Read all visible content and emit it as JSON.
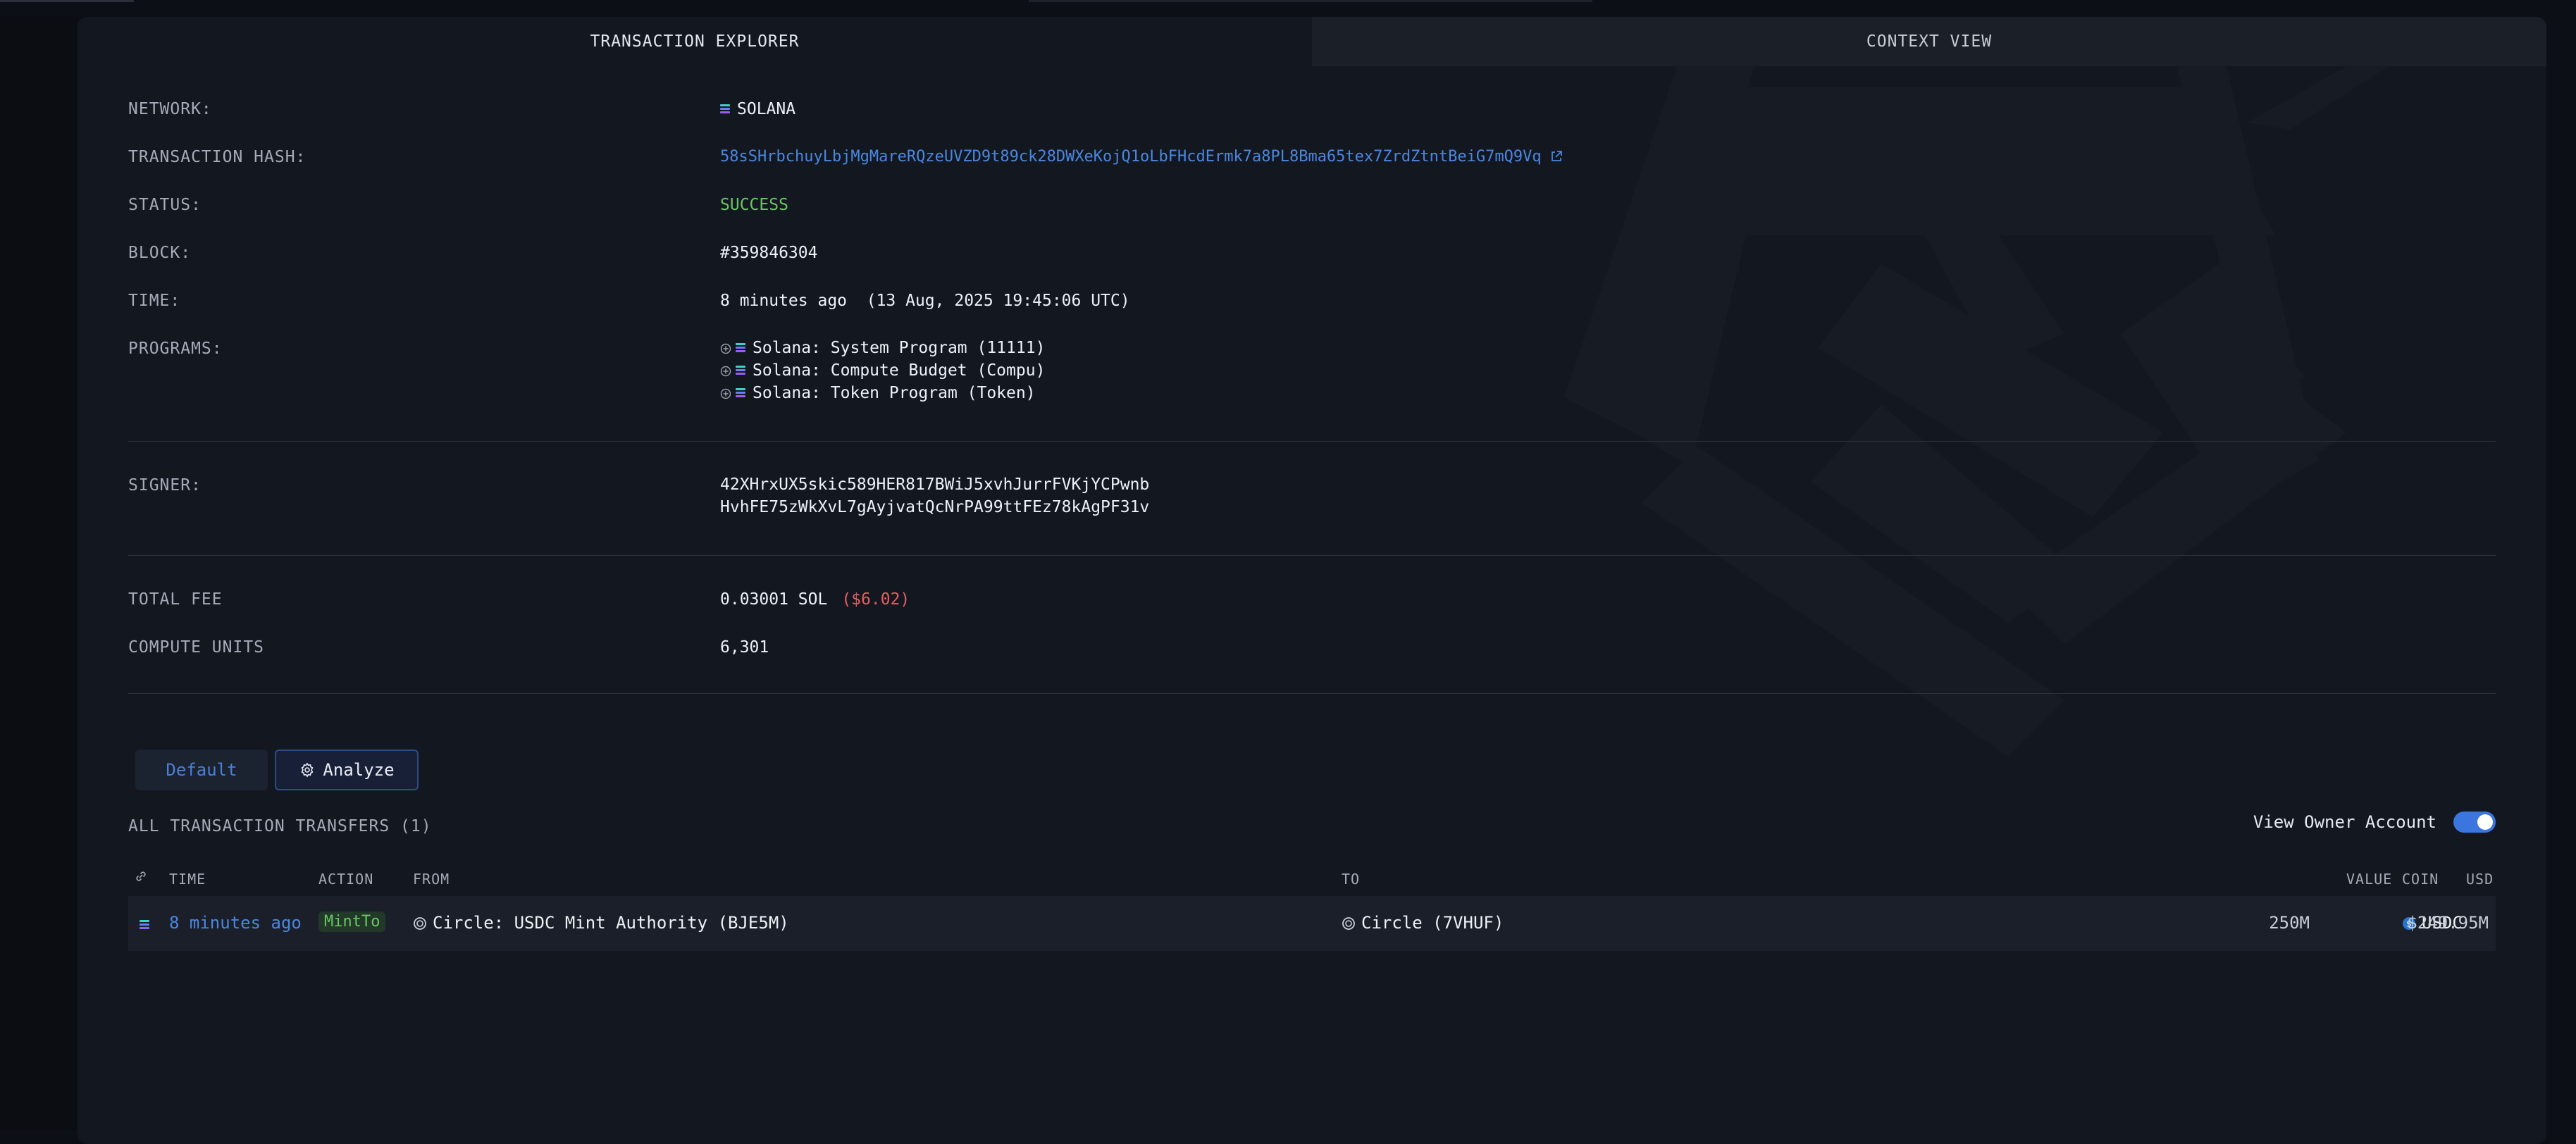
{
  "tabs": {
    "explorer": "TRANSACTION EXPLORER",
    "context": "CONTEXT VIEW"
  },
  "details": {
    "network": {
      "label": "NETWORK:",
      "value": "SOLANA"
    },
    "hash": {
      "label": "TRANSACTION HASH:",
      "value": "58sSHrbchuyLbjMgMareRQzeUVZD9t89ck28DWXeKojQ1oLbFHcdErmk7a8PL8Bma65tex7ZrdZtntBeiG7mQ9Vq"
    },
    "status": {
      "label": "STATUS:",
      "value": "SUCCESS"
    },
    "block": {
      "label": "BLOCK:",
      "value": "#359846304"
    },
    "time": {
      "label": "TIME:",
      "relative": "8 minutes ago",
      "absolute": "(13 Aug, 2025 19:45:06 UTC)"
    },
    "programs": {
      "label": "PROGRAMS:",
      "items": [
        "Solana: System Program (11111)",
        "Solana: Compute Budget (Compu)",
        "Solana: Token Program (Token)"
      ]
    },
    "signer": {
      "label": "SIGNER:",
      "lines": [
        "42XHrxUX5skic589HER817BWiJ5xvhJurrFVKjYCPwnb",
        "HvhFE75zWkXvL7gAyjvatQcNrPA99ttFEz78kAgPF31v"
      ]
    },
    "fee": {
      "label": "TOTAL FEE",
      "value": "0.03001 SOL",
      "usd": "($6.02)"
    },
    "compute": {
      "label": "COMPUTE UNITS",
      "value": "6,301"
    }
  },
  "buttons": {
    "default": "Default",
    "analyze": "Analyze"
  },
  "transfers": {
    "title": "ALL TRANSACTION TRANSFERS (1)",
    "owner_toggle_label": "View Owner Account",
    "owner_toggle_on": true,
    "columns": {
      "time": "TIME",
      "action": "ACTION",
      "from": "FROM",
      "to": "TO",
      "value": "VALUE",
      "coin": "COIN",
      "usd": "USD"
    },
    "rows": [
      {
        "time": "8 minutes ago",
        "action": "MintTo",
        "from": "Circle: USDC Mint Authority (BJE5M)",
        "to": "Circle (7VHUF)",
        "value": "250M",
        "coin": "USDC",
        "usd": "$249.95M"
      }
    ]
  },
  "colors": {
    "accent": "#4a87e0",
    "success": "#6cc464",
    "fee_usd": "#e06060",
    "panel": "#131720"
  },
  "icons": [
    "solana-icon",
    "external-link-icon",
    "plus-circle-icon",
    "gear-icon",
    "link-icon",
    "circle-logo-icon",
    "usdc-icon"
  ]
}
